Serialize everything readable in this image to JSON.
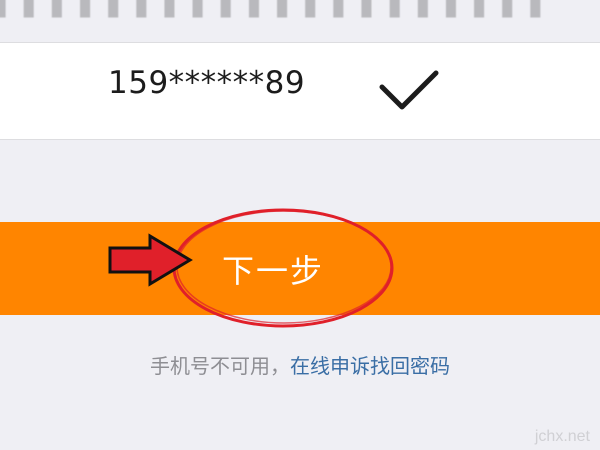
{
  "account": {
    "phone_masked": "159******89"
  },
  "actions": {
    "next_label": "下一步"
  },
  "help": {
    "unavailable_text": "手机号不可用，",
    "appeal_link": "在线申诉找回密码"
  },
  "watermark": {
    "text": "jchx.net"
  },
  "colors": {
    "button_orange": "#ff8500",
    "annotation_red": "#e0202a",
    "link_blue": "#3a6ea5"
  },
  "icons": {
    "selected": "checkmark-icon"
  }
}
